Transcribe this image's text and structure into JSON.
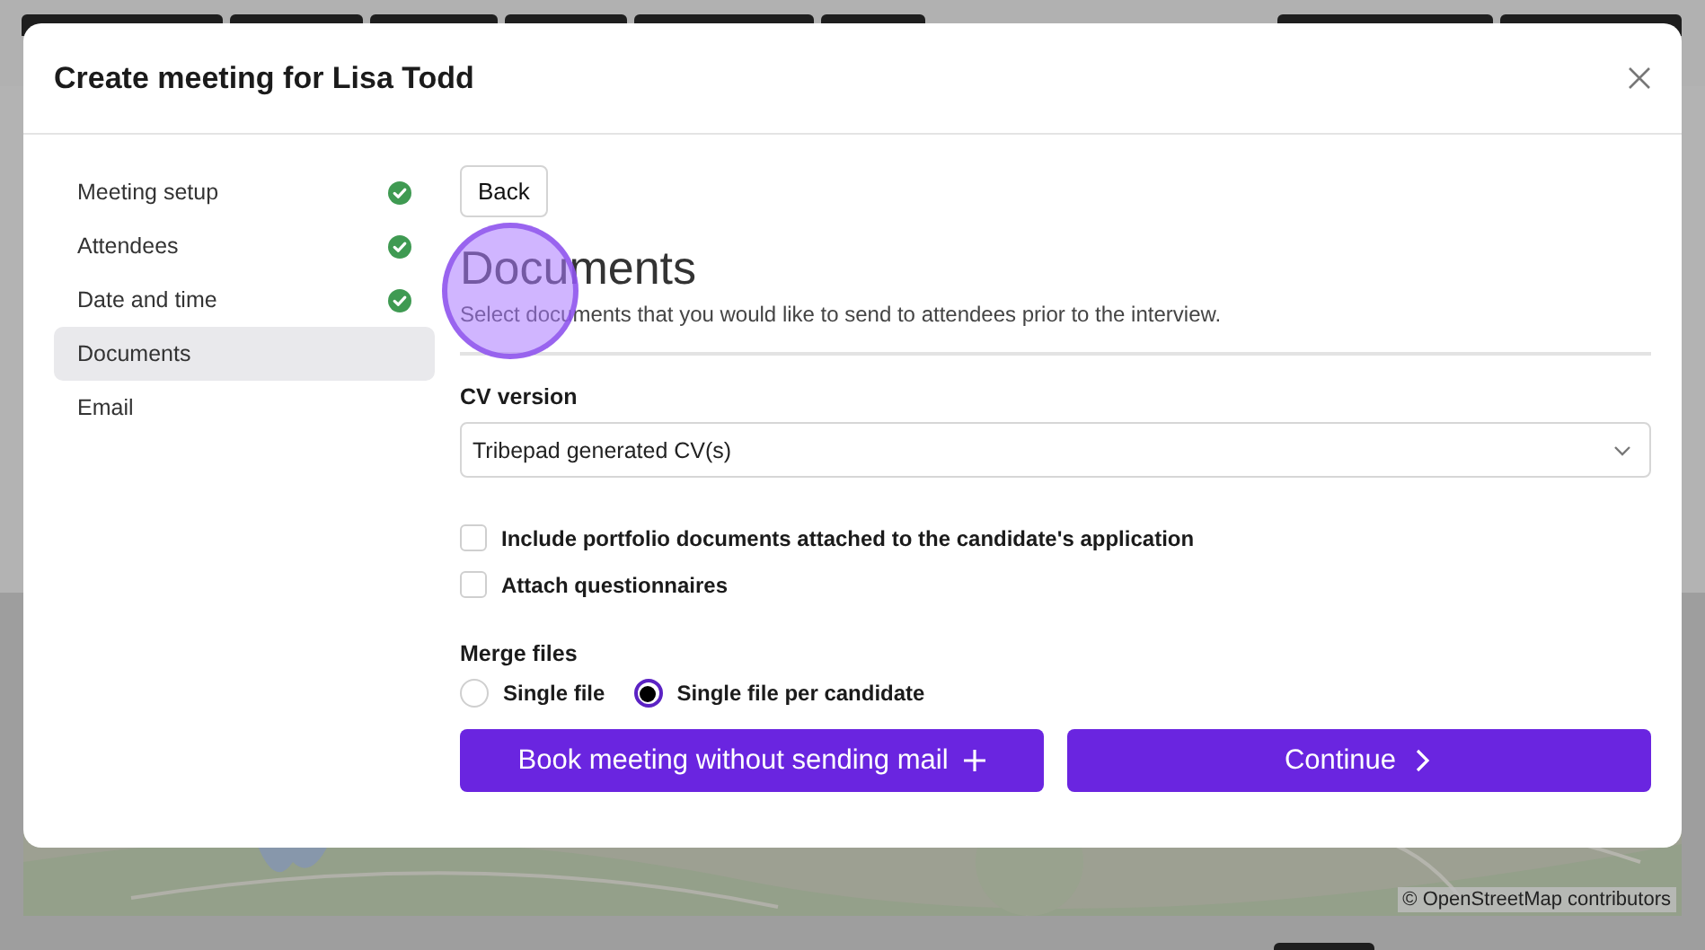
{
  "dialog": {
    "title": "Create meeting for Lisa Todd"
  },
  "steps": [
    {
      "label": "Meeting setup",
      "completed": true,
      "selected": false
    },
    {
      "label": "Attendees",
      "completed": true,
      "selected": false
    },
    {
      "label": "Date and time",
      "completed": true,
      "selected": false
    },
    {
      "label": "Documents",
      "completed": false,
      "selected": true
    },
    {
      "label": "Email",
      "completed": false,
      "selected": false
    }
  ],
  "back_button": "Back",
  "heading": "Documents",
  "description": "Select documents that you would like to send to attendees prior to the interview.",
  "cv_version": {
    "label": "CV version",
    "value": "Tribepad generated CV(s)"
  },
  "options": [
    {
      "label": "Include portfolio documents attached to the candidate's application",
      "checked": false
    },
    {
      "label": "Attach questionnaires",
      "checked": false
    }
  ],
  "merge_files": {
    "label": "Merge files",
    "choices": [
      {
        "label": "Single file",
        "selected": false
      },
      {
        "label": "Single file per candidate",
        "selected": true
      }
    ]
  },
  "actions": [
    {
      "label": "Book meeting without sending mail",
      "kind": "plus"
    },
    {
      "label": "Continue",
      "kind": "next"
    }
  ],
  "map": {
    "attribution": "© OpenStreetMap contributors"
  }
}
